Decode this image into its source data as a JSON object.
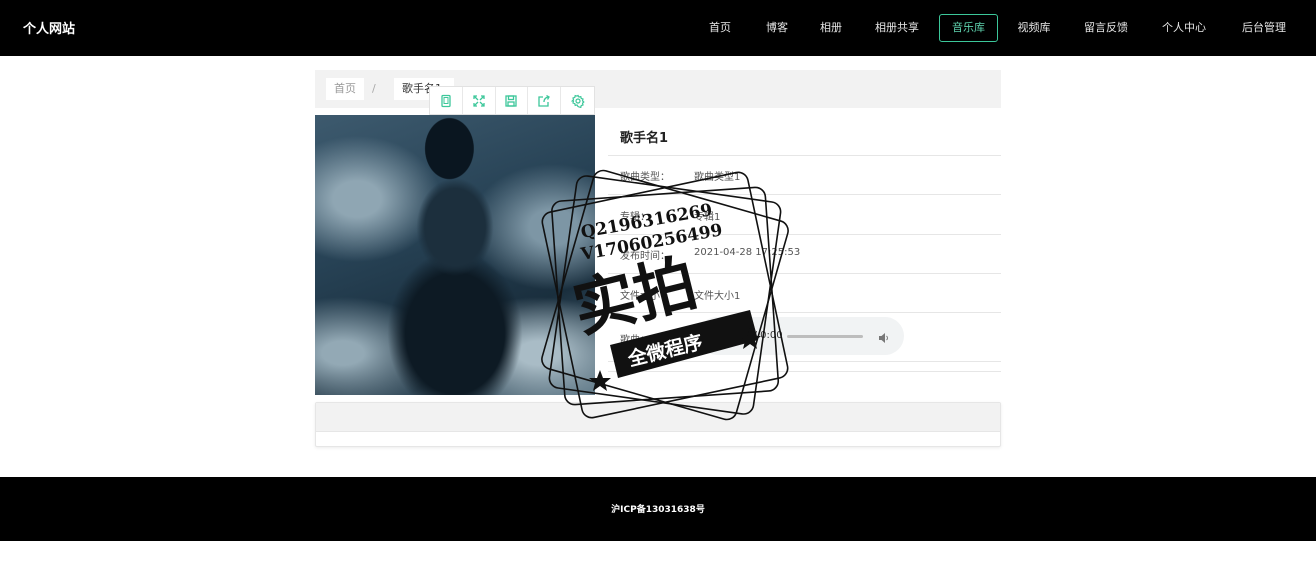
{
  "header": {
    "site_title": "个人网站",
    "nav": [
      {
        "label": "首页"
      },
      {
        "label": "博客"
      },
      {
        "label": "相册"
      },
      {
        "label": "相册共享"
      },
      {
        "label": "音乐库",
        "active": true
      },
      {
        "label": "视频库"
      },
      {
        "label": "留言反馈"
      },
      {
        "label": "个人中心"
      },
      {
        "label": "后台管理"
      }
    ]
  },
  "breadcrumb": {
    "home": "首页",
    "separator": "/",
    "current": "歌手名1"
  },
  "toolbar": {
    "icons": [
      "tablet-icon",
      "fullscreen-icon",
      "save-icon",
      "share-icon",
      "settings-icon"
    ]
  },
  "detail": {
    "title": "歌手名1",
    "fields": [
      {
        "label": "歌曲类型：",
        "value": "歌曲类型1"
      },
      {
        "label": "专辑：",
        "value": "专辑1"
      },
      {
        "label": "发布时间：",
        "value": "2021-04-28 17:25:53"
      },
      {
        "label": "文件大小：",
        "value": "文件大小1"
      }
    ],
    "song_label": "歌曲：",
    "player": {
      "time": "0:00 / 0:00",
      "progress": 0
    }
  },
  "watermark": {
    "line1": "Q2196316269",
    "line2": "V17060256499",
    "main": "实拍",
    "banner": "全微程序"
  },
  "footer": {
    "icp": "沪ICP备13031638号"
  },
  "colors": {
    "nav_bg": "#000000",
    "accent": "#3cc79a"
  }
}
